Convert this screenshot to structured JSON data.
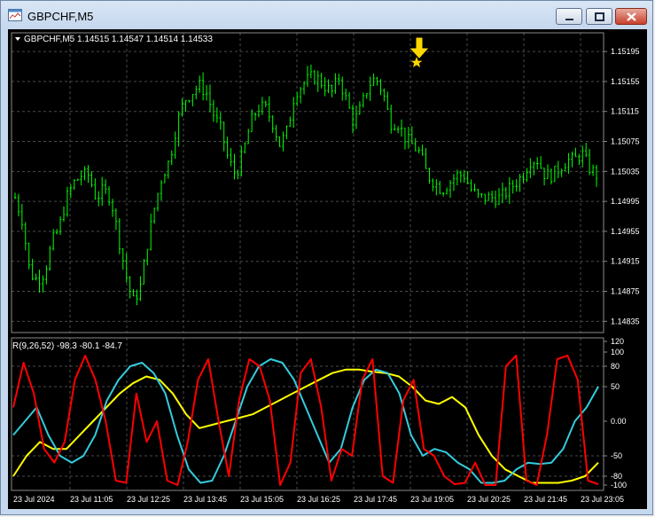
{
  "window": {
    "title": "GBPCHF,M5",
    "controls": {
      "minimize": "minimize-button",
      "maximize": "maximize-button",
      "close": "close-button"
    }
  },
  "colors": {
    "background": "#000000",
    "grid": "#4a4a4a",
    "axis_text": "#ffffff",
    "candle": "#00ff00",
    "rsi_fast": "#ff0000",
    "rsi_mid": "#33ccdd",
    "rsi_slow": "#ffff00",
    "marker": "#ffd700"
  },
  "main_panel": {
    "label": "GBPCHF,M5  1.14515 1.14547 1.14514 1.14533",
    "price_ticks": [
      "1.15195",
      "1.15155",
      "1.15115",
      "1.15075",
      "1.15035",
      "1.14995",
      "1.14955",
      "1.14915",
      "1.14875",
      "1.14835"
    ]
  },
  "indicator_panel": {
    "label": "R(9,26,52) -98.3 -80.1 -84.7",
    "value_ticks": [
      "120",
      "100",
      "80",
      "50",
      "0.00",
      "-50",
      "-80",
      "-100"
    ]
  },
  "time_axis": {
    "labels": [
      "23 Jul 2024",
      "23 Jul 11:05",
      "23 Jul 12:25",
      "23 Jul 13:45",
      "23 Jul 15:05",
      "23 Jul 16:25",
      "23 Jul 17:45",
      "23 Jul 19:05",
      "23 Jul 20:25",
      "23 Jul 21:45",
      "23 Jul 23:05"
    ]
  },
  "chart_data": [
    {
      "type": "candlestick",
      "symbol": "GBPCHF",
      "timeframe": "M5",
      "title": "GBPCHF,M5",
      "ohlc_last": [
        1.14515,
        1.14547,
        1.14514,
        1.14533
      ],
      "ylim": [
        1.1482,
        1.1522
      ],
      "price_path": {
        "x": [
          "10:00",
          "10:10",
          "10:20",
          "10:30",
          "10:40",
          "10:50",
          "11:00",
          "11:10",
          "11:20",
          "11:30",
          "11:40",
          "11:50",
          "12:00",
          "12:10",
          "12:20",
          "12:30",
          "12:40",
          "12:50",
          "13:00",
          "13:10",
          "13:20",
          "13:30",
          "13:40",
          "13:50",
          "14:00",
          "14:10",
          "14:20",
          "14:30",
          "14:40",
          "14:50",
          "15:00",
          "15:10",
          "15:20",
          "15:30",
          "15:40",
          "15:50",
          "16:00",
          "16:10",
          "16:20",
          "16:30",
          "16:40",
          "16:50",
          "17:00",
          "17:10",
          "17:20",
          "17:30",
          "17:40",
          "17:50",
          "18:00",
          "18:10",
          "18:20",
          "18:30",
          "18:40",
          "18:50",
          "19:00",
          "19:10",
          "19:20",
          "19:30",
          "19:40",
          "19:50",
          "20:00",
          "20:10",
          "20:20",
          "20:30",
          "20:40",
          "20:50",
          "21:00",
          "21:10",
          "21:20",
          "21:30",
          "21:40",
          "21:50",
          "22:00",
          "22:10",
          "22:20",
          "22:30",
          "22:40",
          "22:50",
          "23:00",
          "23:10"
        ],
        "close": [
          1.15,
          1.1497,
          1.149,
          1.1489,
          1.149,
          1.1494,
          1.1496,
          1.15,
          1.1502,
          1.1503,
          1.1503,
          1.15,
          1.1501,
          1.15,
          1.1495,
          1.149,
          1.1486,
          1.1488,
          1.1494,
          1.1499,
          1.1503,
          1.1505,
          1.151,
          1.1513,
          1.1514,
          1.1515,
          1.1514,
          1.1511,
          1.1509,
          1.1505,
          1.1503,
          1.1506,
          1.151,
          1.1512,
          1.1512,
          1.151,
          1.1507,
          1.1509,
          1.1514,
          1.1515,
          1.1516,
          1.1516,
          1.1515,
          1.1514,
          1.1516,
          1.1513,
          1.151,
          1.1512,
          1.1515,
          1.1516,
          1.1514,
          1.151,
          1.151,
          1.1508,
          1.1507,
          1.1506,
          1.1503,
          1.1502,
          1.1501,
          1.1502,
          1.1503,
          1.1503,
          1.1501,
          1.15,
          1.15,
          1.15,
          1.15,
          1.1501,
          1.1502,
          1.1503,
          1.1505,
          1.1505,
          1.1503,
          1.1503,
          1.1504,
          1.1505,
          1.1505,
          1.1506,
          1.1504,
          1.1503
        ]
      },
      "annotations": [
        {
          "type": "arrow-down-with-star",
          "x": "18:50",
          "color": "#ffd700"
        }
      ]
    },
    {
      "type": "line",
      "title": "R(9,26,52)",
      "ylim": [
        -110,
        120
      ],
      "last_values": {
        "R9": -98.3,
        "R26": -80.1,
        "R52": -84.7
      },
      "series": [
        {
          "name": "R(9)",
          "color": "#ff0000",
          "values": [
            20,
            85,
            40,
            -40,
            -60,
            -30,
            60,
            95,
            60,
            0,
            -90,
            -95,
            40,
            -30,
            0,
            -90,
            -100,
            -30,
            60,
            90,
            0,
            -80,
            30,
            90,
            80,
            30,
            -100,
            -60,
            70,
            90,
            20,
            -90,
            -40,
            -50,
            60,
            90,
            -80,
            -95,
            30,
            60,
            -40,
            -50,
            -80,
            -98,
            -95,
            -60,
            -100,
            -100,
            80,
            95,
            -90,
            -100,
            -20,
            90,
            95,
            60,
            -90,
            -98
          ]
        },
        {
          "name": "R(26)",
          "color": "#33ccdd",
          "values": [
            -20,
            0,
            20,
            -20,
            -50,
            -60,
            -50,
            -20,
            30,
            60,
            80,
            85,
            70,
            40,
            -20,
            -70,
            -95,
            -90,
            -50,
            0,
            50,
            80,
            90,
            85,
            60,
            20,
            -20,
            -60,
            -40,
            20,
            60,
            75,
            70,
            40,
            -20,
            -50,
            -40,
            -45,
            -60,
            -70,
            -95,
            -95,
            -90,
            -70,
            -60,
            -62,
            -60,
            -40,
            0,
            20,
            50
          ]
        },
        {
          "name": "R(52)",
          "color": "#ffff00",
          "values": [
            -80,
            -50,
            -30,
            -40,
            -40,
            -20,
            0,
            20,
            40,
            55,
            65,
            60,
            40,
            10,
            -10,
            -5,
            0,
            5,
            10,
            20,
            30,
            40,
            50,
            60,
            70,
            75,
            75,
            72,
            70,
            65,
            50,
            30,
            25,
            35,
            20,
            -20,
            -50,
            -70,
            -80,
            -95,
            -95,
            -95,
            -90,
            -80,
            -60
          ]
        }
      ]
    }
  ]
}
